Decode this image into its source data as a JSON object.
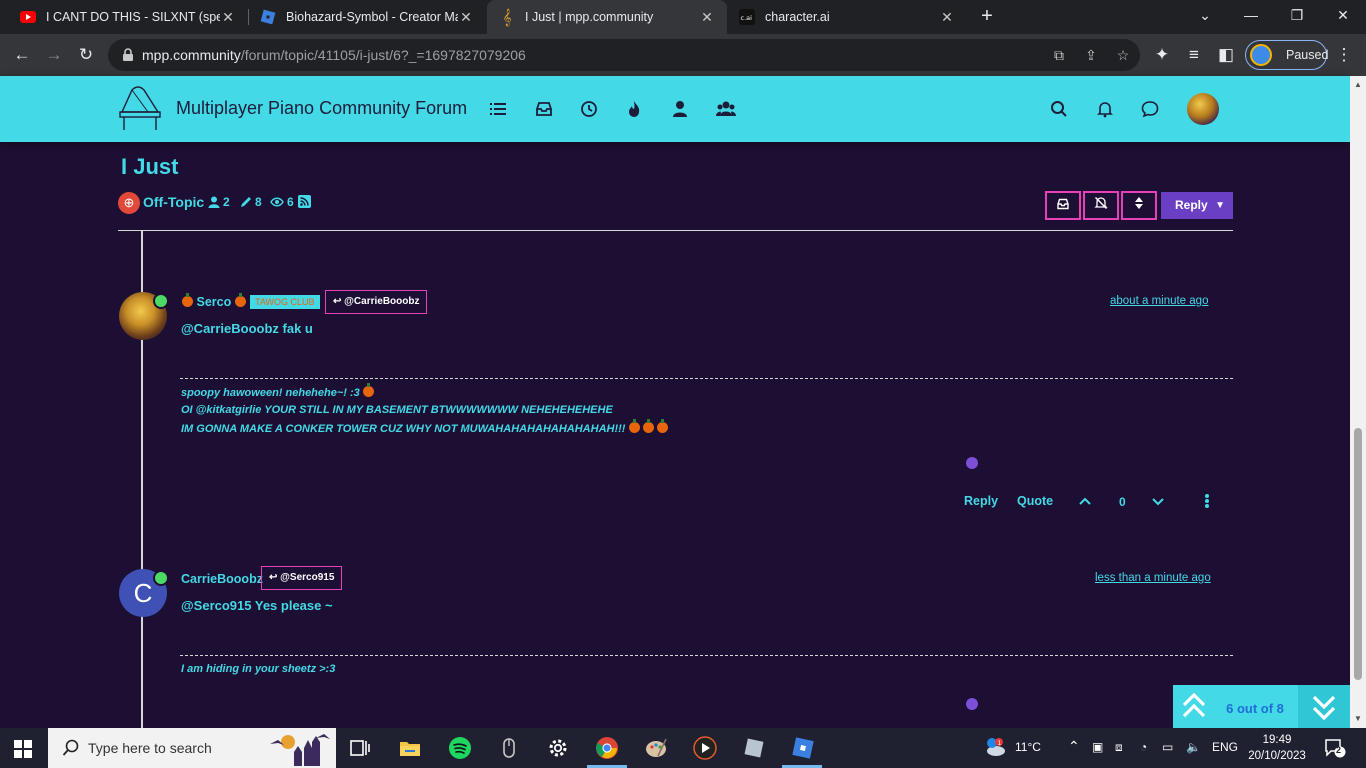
{
  "browser": {
    "tabs": [
      {
        "title": "I CANT DO THIS - SILXNT (sped",
        "icon": "youtube-icon"
      },
      {
        "title": "Biohazard-Symbol - Creator Mar",
        "icon": "roblox-icon"
      },
      {
        "title": "I Just | mpp.community",
        "icon": "treble-clef-icon"
      },
      {
        "title": "character.ai",
        "icon": "cai-icon"
      }
    ],
    "url_host": "mpp.community",
    "url_path": "/forum/topic/41105/i-just/6?_=1697827079206",
    "profile_status": "Paused"
  },
  "forum": {
    "title": "Multiplayer Piano Community Forum"
  },
  "topic": {
    "title": "I Just",
    "category": "Off-Topic",
    "posters": "2",
    "posts": "8",
    "views": "6",
    "reply_label": "Reply"
  },
  "posts": [
    {
      "author": "Serco",
      "badge": "TAWOG CLUB",
      "parent": "@CarrieBooobz",
      "time": "about a minute ago",
      "content": "@CarrieBooobz fak u",
      "signature": [
        "spoopy hawoween! nehehehe~! :3",
        "OI @kitkatgirlie YOUR STILL IN MY BASEMENT BTWWWWWWW NEHEHEHEHEHE",
        "IM GONNA MAKE A CONKER TOWER CUZ WHY NOT MUWAHAHAHAHAHAHAHAH!!!"
      ],
      "reply_label": "Reply",
      "quote_label": "Quote",
      "votes": "0"
    },
    {
      "author": "CarrieBooobz",
      "avatar_letter": "C",
      "parent": "@Serco915",
      "time": "less than a minute ago",
      "content": "@Serco915 Yes please ~",
      "signature": [
        "I am hiding in your sheetz >:3"
      ]
    }
  ],
  "pagination": {
    "label": "6 out of 8"
  },
  "taskbar": {
    "search_placeholder": "Type here to search",
    "weather": "11°C",
    "language": "ENG",
    "time": "19:49",
    "date": "20/10/2023",
    "notifications": "2"
  },
  "colors": {
    "accent": "#44d9e6",
    "background": "#1d0e33",
    "button_border": "#e93fb7",
    "reply_button": "#6a3fc4"
  }
}
